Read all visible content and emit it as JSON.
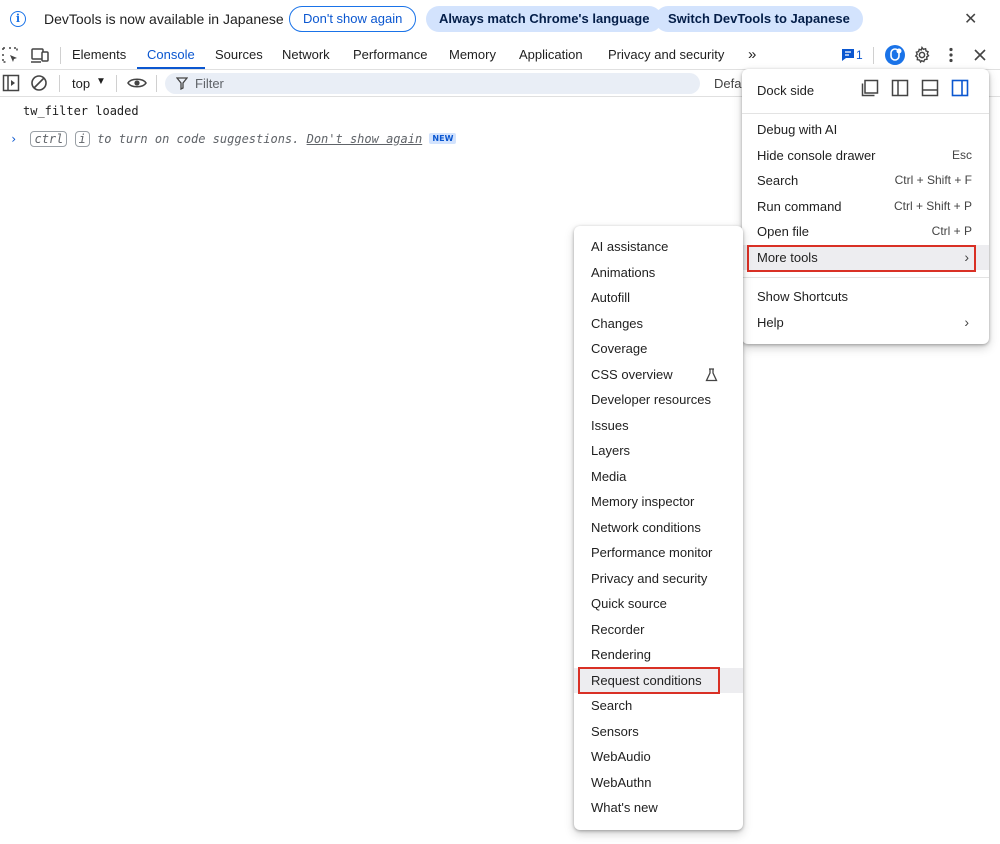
{
  "infobar": {
    "message": "DevTools is now available in Japanese",
    "dont_show": "Don't show again",
    "always_match": "Always match Chrome's language",
    "switch": "Switch DevTools to Japanese",
    "close": "✕"
  },
  "tabs": [
    "Elements",
    "Console",
    "Sources",
    "Network",
    "Performance",
    "Memory",
    "Application",
    "Privacy and security"
  ],
  "tab_overflow": "»",
  "issues_count": "1",
  "console_toolbar": {
    "context": "top",
    "filter_placeholder": "Filter",
    "levels": "Defa"
  },
  "console": {
    "log_line": "tw_filter loaded",
    "hint_prefix": "ctrl",
    "hint_key": "i",
    "hint_text": " to turn on code suggestions. ",
    "hint_link": "Don't show again",
    "hint_badge": "NEW"
  },
  "main_menu": {
    "dock_side": "Dock side",
    "items": [
      {
        "label": "Debug with AI",
        "shortcut": ""
      },
      {
        "label": "Hide console drawer",
        "shortcut": "Esc"
      },
      {
        "label": "Search",
        "shortcut": "Ctrl + Shift + F"
      },
      {
        "label": "Run command",
        "shortcut": "Ctrl + Shift + P"
      },
      {
        "label": "Open file",
        "shortcut": "Ctrl + P"
      },
      {
        "label": "More tools",
        "shortcut": ""
      }
    ],
    "show_shortcuts": "Show Shortcuts",
    "help": "Help",
    "submenu_arrow": "›"
  },
  "more_tools": [
    "AI assistance",
    "Animations",
    "Autofill",
    "Changes",
    "Coverage",
    "CSS overview",
    "Developer resources",
    "Issues",
    "Layers",
    "Media",
    "Memory inspector",
    "Network conditions",
    "Performance monitor",
    "Privacy and security",
    "Quick source",
    "Recorder",
    "Rendering",
    "Request conditions",
    "Search",
    "Sensors",
    "WebAudio",
    "WebAuthn",
    "What's new"
  ],
  "colors": {
    "accent": "#0b57d0",
    "highlight": "#d93025"
  }
}
